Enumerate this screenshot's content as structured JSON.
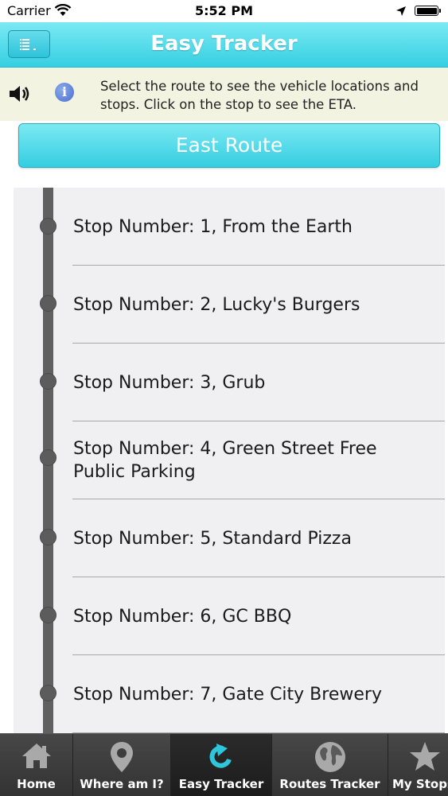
{
  "status_bar": {
    "carrier": "Carrier",
    "time": "5:52 PM"
  },
  "header": {
    "title": "Easy Tracker",
    "menu_icon": "list-menu-icon"
  },
  "info": {
    "text": "Select the route to see the vehicle locations and stops. Click on the stop to see the ETA.",
    "icons": [
      "speaker-icon",
      "info-icon"
    ]
  },
  "route": {
    "label": "East Route"
  },
  "stops": [
    {
      "label": "Stop Number: 1, From the Earth"
    },
    {
      "label": "Stop Number: 2, Lucky's Burgers"
    },
    {
      "label": "Stop Number: 3, Grub"
    },
    {
      "label": "Stop Number: 4, Green Street Free Public Parking"
    },
    {
      "label": "Stop Number: 5, Standard Pizza"
    },
    {
      "label": "Stop Number: 6, GC BBQ"
    },
    {
      "label": "Stop Number: 7, Gate City Brewery"
    }
  ],
  "tabs": [
    {
      "label": "Home",
      "icon": "home-icon"
    },
    {
      "label": "Where am I?",
      "icon": "location-pin-icon"
    },
    {
      "label": "Easy Tracker",
      "icon": "refresh-arrow-icon",
      "active": true
    },
    {
      "label": "Routes Tracker",
      "icon": "globe-icon"
    },
    {
      "label": "My Stops",
      "icon": "star-icon"
    }
  ],
  "colors": {
    "header_accent": "#35cfe2",
    "info_background": "#f3f3e2",
    "tab_bar": "#3d3d3d",
    "active_tab_icon": "#2fc6dc"
  }
}
